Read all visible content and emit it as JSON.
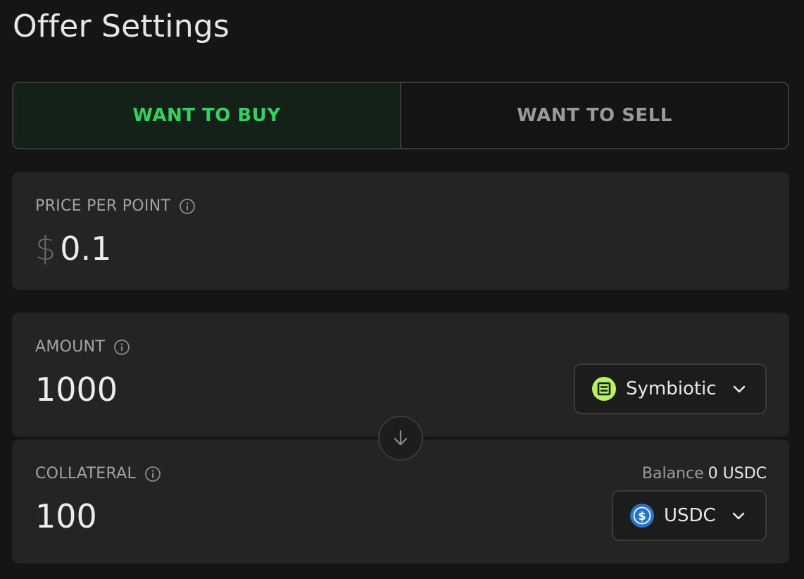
{
  "page": {
    "title": "Offer Settings"
  },
  "toggle": {
    "buy_label": "WANT TO BUY",
    "sell_label": "WANT TO SELL",
    "selected": "buy"
  },
  "price": {
    "label": "PRICE PER POINT",
    "currency_symbol": "$",
    "value": "0.1"
  },
  "amount": {
    "label": "AMOUNT",
    "value": "1000",
    "token": "Symbiotic",
    "token_icon": "symbiotic-logo-icon"
  },
  "collateral": {
    "label": "COLLATERAL",
    "value": "100",
    "balance_label": "Balance",
    "balance_value": "0 USDC",
    "token": "USDC",
    "token_icon": "usdc-logo-icon"
  },
  "colors": {
    "background": "#151515",
    "card": "#242424",
    "buy_active": "#33d15e",
    "symbiotic_green": "#b6f35a",
    "usdc_blue": "#2775ca"
  }
}
